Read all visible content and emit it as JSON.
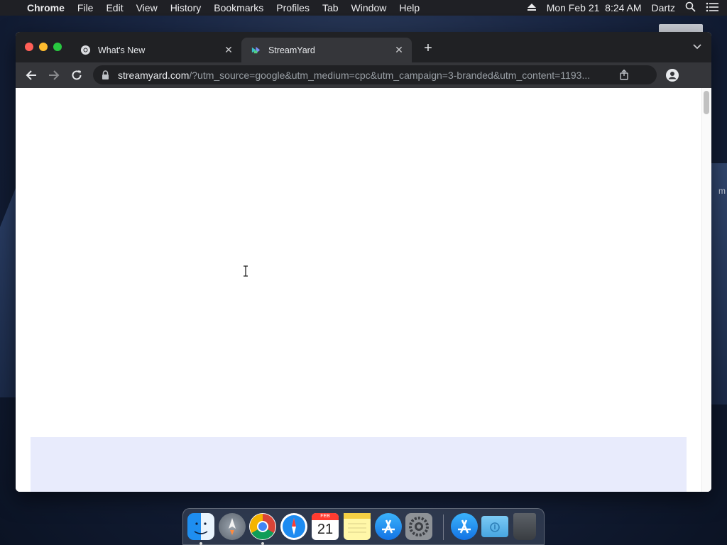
{
  "menubar": {
    "app_name": "Chrome",
    "items": [
      "File",
      "Edit",
      "View",
      "History",
      "Bookmarks",
      "Profiles",
      "Tab",
      "Window",
      "Help"
    ],
    "datetime": "Mon Feb 21  8:24 AM",
    "user": "Dartz"
  },
  "browser": {
    "tabs": [
      {
        "title": "What's New",
        "active": false
      },
      {
        "title": "StreamYard",
        "active": true
      }
    ],
    "address": {
      "host": "streamyard.com",
      "path": "/?utm_source=google&utm_medium=cpc&utm_campaign=3-branded&utm_content=1193..."
    }
  },
  "page": {
    "banner_color": "#e8ebfc"
  },
  "desktop": {
    "side_text": "m"
  },
  "dock": {
    "calendar_month": "FEB",
    "calendar_day": "21",
    "icons": [
      "finder-icon",
      "launchpad-icon",
      "chrome-icon",
      "safari-icon",
      "calendar-icon",
      "notes-icon",
      "app-store-icon",
      "system-preferences-icon",
      "app-store-icon",
      "downloads-folder-icon",
      "trash-icon"
    ]
  }
}
